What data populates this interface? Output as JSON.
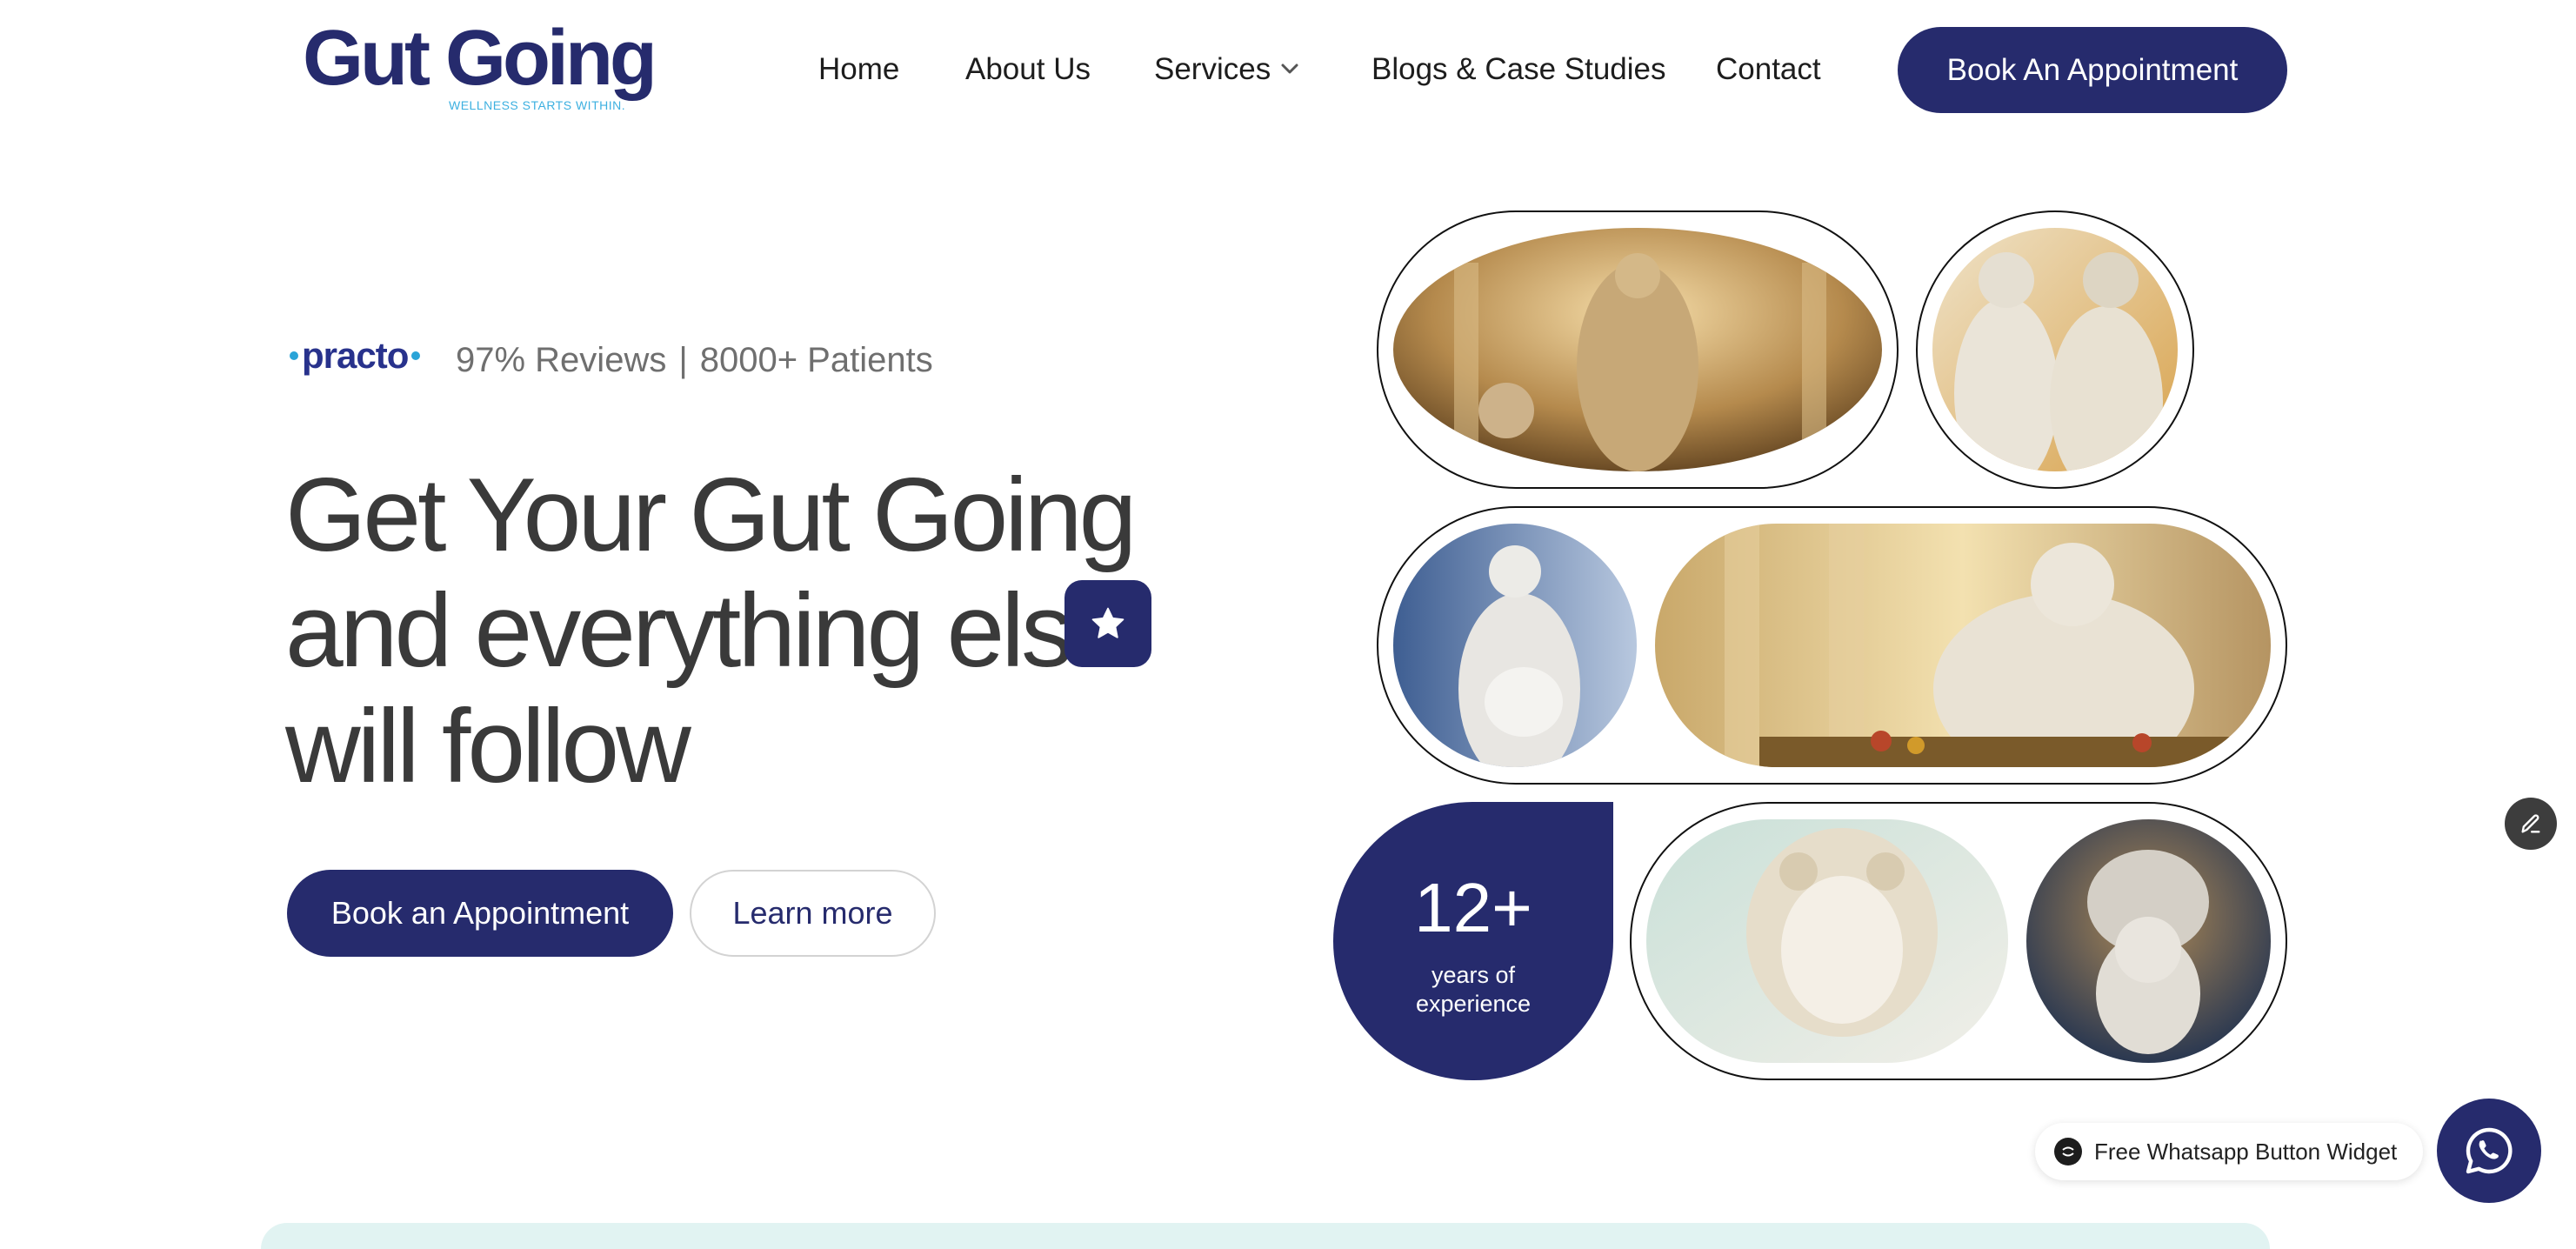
{
  "header": {
    "logo": {
      "name": "Gut Going",
      "tagline": "WELLNESS STARTS WITHIN."
    },
    "nav": [
      {
        "label": "Home"
      },
      {
        "label": "About Us"
      },
      {
        "label": "Services"
      },
      {
        "label": "Blogs & Case Studies"
      },
      {
        "label": "Contact"
      }
    ],
    "services_dropdown_icon": "chevron-down-icon",
    "cta_label": "Book An Appointment"
  },
  "hero": {
    "brand": "practo",
    "reviews": "97% Reviews",
    "separator": "|",
    "patients": "8000+ Patients",
    "headline": [
      "Get Your Gut Going",
      "and everything else",
      "will follow"
    ],
    "badge_icon": "star-icon",
    "primary_cta": "Book an Appointment",
    "secondary_cta": "Learn more"
  },
  "collage": {
    "stat_value": "12+",
    "stat_label": "years of experience",
    "images": [
      "statue-athlete-image",
      "statue-physician-image",
      "statue-pregnant-woman-image",
      "statue-feast-image",
      "statue-medusa-image",
      "statue-head-massage-image"
    ]
  },
  "floating": {
    "edit_icon": "pencil-icon",
    "whatsapp_widget_label": "Free Whatsapp Button Widget",
    "whatsapp_icon": "whatsapp-icon"
  },
  "colors": {
    "primary": "#262b6d",
    "accent": "#2aa4d8",
    "text": "#3a3a3a",
    "muted": "#6f6f6f"
  }
}
